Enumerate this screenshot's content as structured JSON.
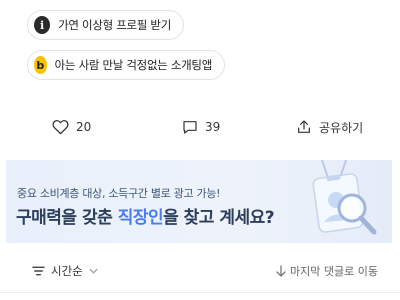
{
  "chips": [
    {
      "icon": "info-icon",
      "icon_glyph": "i",
      "label": "가연 이상형 프로필 받기"
    },
    {
      "icon": "b-badge-icon",
      "icon_glyph": "b",
      "label": "아는 사람 만날 걱정없는 소개팅앱"
    }
  ],
  "actions": {
    "like_count": "20",
    "comment_count": "39",
    "share_label": "공유하기"
  },
  "banner": {
    "line1": "중요 소비계층 대상, 소득구간 별로 광고 가능!",
    "line2_part1": "구매력을 갖춘 ",
    "line2_highlight": "직장인",
    "line2_part2": "을 찾고 계세요?"
  },
  "sortbar": {
    "sort_label": "시간순",
    "jump_label": "마지막 댓글로 이동"
  },
  "colors": {
    "accent": "#4a7cf0",
    "badge_yellow": "#f5c300",
    "banner_bg": "#e8f0fb"
  }
}
